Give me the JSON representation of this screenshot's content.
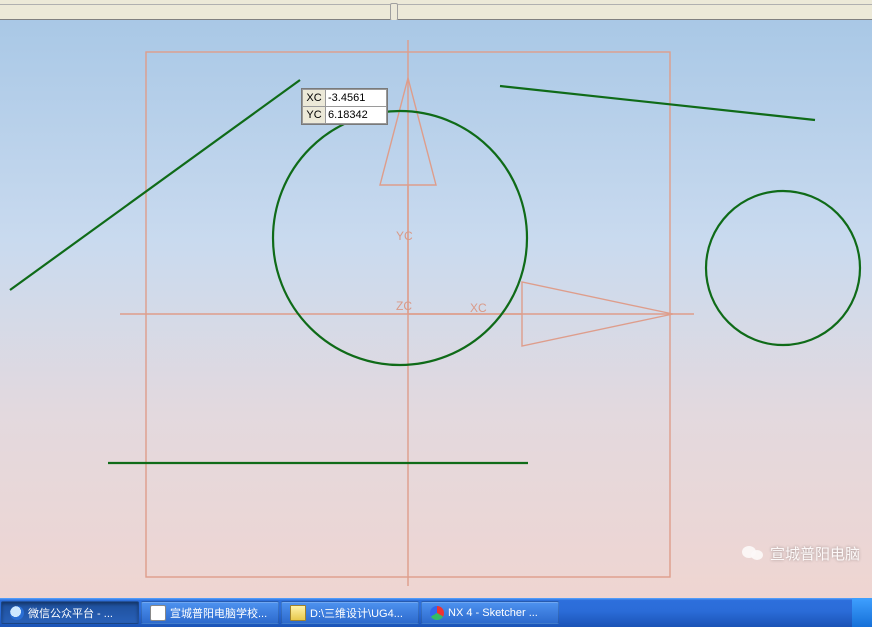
{
  "coord_input": {
    "xc_label": "XC",
    "xc_value": "-3.4561",
    "yc_label": "YC",
    "yc_value": "6.18342"
  },
  "axes": {
    "xc": "XC",
    "yc": "YC",
    "zc": "ZC"
  },
  "watermark": {
    "text": "宣城普阳电脑"
  },
  "taskbar": {
    "items": [
      {
        "label": "微信公众平台 - ...",
        "icon": "ie-icon",
        "active": true
      },
      {
        "label": "宣城普阳电脑学校...",
        "icon": "app-icon",
        "active": false
      },
      {
        "label": "D:\\三维设计\\UG4...",
        "icon": "folder-icon",
        "active": false
      },
      {
        "label": "NX 4 - Sketcher ...",
        "icon": "nx-icon",
        "active": false
      }
    ]
  }
}
